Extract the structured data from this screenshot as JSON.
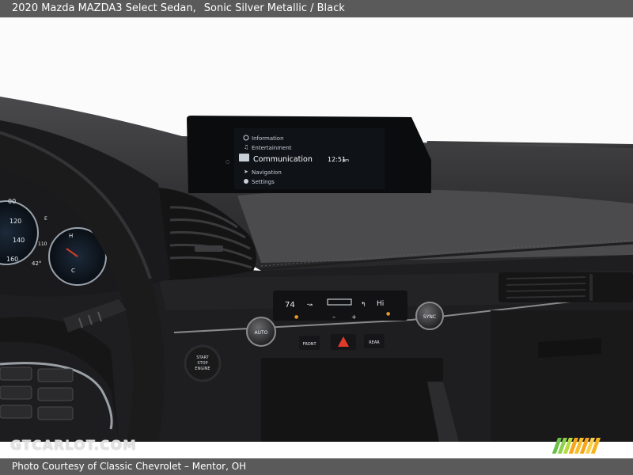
{
  "caption": {
    "vehicle": "2020 Mazda MAZDA3 Select Sedan,",
    "color": "Sonic Silver Metallic / Black"
  },
  "screen": {
    "menu": {
      "information": "Information",
      "entertainment": "Entertainment",
      "communication": "Communication",
      "navigation": "Navigation",
      "settings": "Settings"
    },
    "time": "12:51",
    "time_suffix": "pm"
  },
  "gauges": {
    "speed_ticks": [
      "120",
      "140",
      "160"
    ],
    "speed_partial": "00",
    "temp": "42°",
    "tach_label": "H",
    "fuel_c": "C",
    "fuel_label": "E",
    "tick_110": "110"
  },
  "climate": {
    "temp_left": "74",
    "fan_high": "Hi",
    "auto_label": "AUTO",
    "sync_label": "SYNC",
    "minus": "–",
    "plus": "+",
    "front": "FRONT",
    "rear": "REAR"
  },
  "start_button": {
    "line1": "START",
    "line2": "STOP",
    "line3": "ENGINE"
  },
  "watermark": "GTCARLOT.COM",
  "footer": "Photo Courtesy of Classic Chevrolet – Mentor, OH",
  "colors": {
    "bar": "#5a5a5a",
    "dash": "#2a2a2b",
    "screen": "#0e1114",
    "logo_green": "#6cc04a",
    "logo_orange": "#f7a51c"
  }
}
